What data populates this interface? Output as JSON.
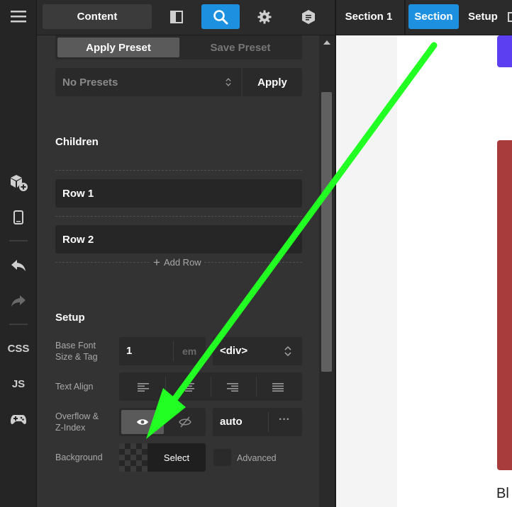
{
  "topbar": {
    "content_label": "Content",
    "tabs": [
      {
        "label": "Section 1"
      },
      {
        "label": "Section"
      },
      {
        "label": "Setup"
      }
    ]
  },
  "rail": {
    "css_label": "CSS",
    "js_label": "JS"
  },
  "presets": {
    "apply_preset": "Apply Preset",
    "save_preset": "Save Preset",
    "select_value": "No Presets",
    "apply": "Apply"
  },
  "children": {
    "heading": "Children",
    "rows": [
      "Row 1",
      "Row 2"
    ],
    "add_row": "Add Row"
  },
  "setup": {
    "heading": "Setup",
    "base_font_label_1": "Base Font",
    "base_font_label_2": "Size & Tag",
    "base_font_value": "1",
    "base_font_unit": "em",
    "tag_value": "<div>",
    "text_align_label": "Text Align",
    "overflow_label_1": "Overflow &",
    "overflow_label_2": "Z-Index",
    "zindex_value": "auto",
    "background_label": "Background",
    "select_label": "Select",
    "advanced_label": "Advanced"
  },
  "preview": {
    "text": "Bl"
  },
  "colors": {
    "accent": "#1e90e0",
    "arrow": "#22ff22",
    "panel_bg": "#333333"
  }
}
